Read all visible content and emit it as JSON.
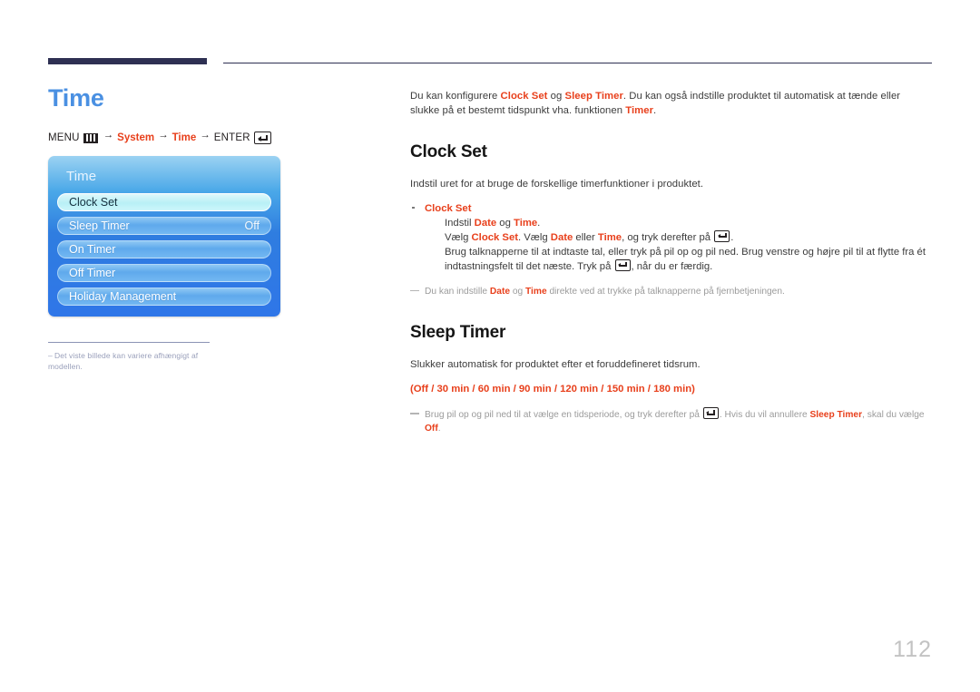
{
  "page": {
    "number": "112",
    "title": "Time"
  },
  "menu_path": {
    "menu_label": "MENU",
    "menu_icon": "menu-bars-icon",
    "arrow": "→",
    "step1": "System",
    "step2": "Time",
    "enter_label": "ENTER",
    "enter_icon": "enter-key-icon"
  },
  "osd": {
    "title": "Time",
    "rows": [
      {
        "label": "Clock Set",
        "value": "",
        "selected": true
      },
      {
        "label": "Sleep Timer",
        "value": "Off",
        "selected": false
      },
      {
        "label": "On Timer",
        "value": "",
        "selected": false
      },
      {
        "label": "Off Timer",
        "value": "",
        "selected": false
      },
      {
        "label": "Holiday Management",
        "value": "",
        "selected": false
      }
    ]
  },
  "left_note": {
    "dash": "–",
    "text": "Det viste billede kan variere afhængigt af modellen."
  },
  "intro": {
    "p1_a": "Du kan konfigurere ",
    "p1_b": "Clock Set",
    "p1_c": " og ",
    "p1_d": "Sleep Timer",
    "p1_e": ". Du kan også indstille produktet til automatisk at tænde eller slukke på et bestemt tidspunkt vha. funktionen ",
    "p1_f": "Timer",
    "p1_g": "."
  },
  "clock_set": {
    "heading": "Clock Set",
    "intro": "Indstil uret for at bruge de forskellige timerfunktioner i produktet.",
    "bullet_head": "Clock Set",
    "line1_a": "Indstil ",
    "line1_b": "Date",
    "line1_c": " og ",
    "line1_d": "Time",
    "line1_e": ".",
    "line2_a": "Vælg ",
    "line2_b": "Clock Set",
    "line2_c": ". Vælg ",
    "line2_d": "Date",
    "line2_e": " eller ",
    "line2_f": "Time",
    "line2_g": ", og tryk derefter på ",
    "line2_h": ".",
    "line3_a": "Brug talknapperne til at indtaste tal, eller tryk på pil op og pil ned. Brug venstre og højre pil til at flytte fra ét indtastningsfelt til det næste. Tryk på ",
    "line3_b": ", når du er færdig.",
    "note_a": "Du kan indstille ",
    "note_b": "Date",
    "note_c": " og ",
    "note_d": "Time",
    "note_e": " direkte ved at trykke på talknapperne på fjernbetjeningen."
  },
  "sleep_timer": {
    "heading": "Sleep Timer",
    "intro": "Slukker automatisk for produktet efter et foruddefineret tidsrum.",
    "options": "(Off / 30 min / 60 min / 90 min / 120 min / 150 min / 180 min)",
    "note_a": "Brug pil op og pil ned til at vælge en tidsperiode, og tryk derefter på ",
    "note_b": ". Hvis du vil annullere ",
    "note_c": "Sleep Timer",
    "note_d": ", skal du vælge ",
    "note_e": "Off",
    "note_f": "."
  },
  "colors": {
    "title_blue": "#4a90e2",
    "accent_red": "#e8401c",
    "rule_navy": "#2e3053",
    "osd_blue": "#2f7de0",
    "page_number_gray": "#c3c3c3"
  }
}
